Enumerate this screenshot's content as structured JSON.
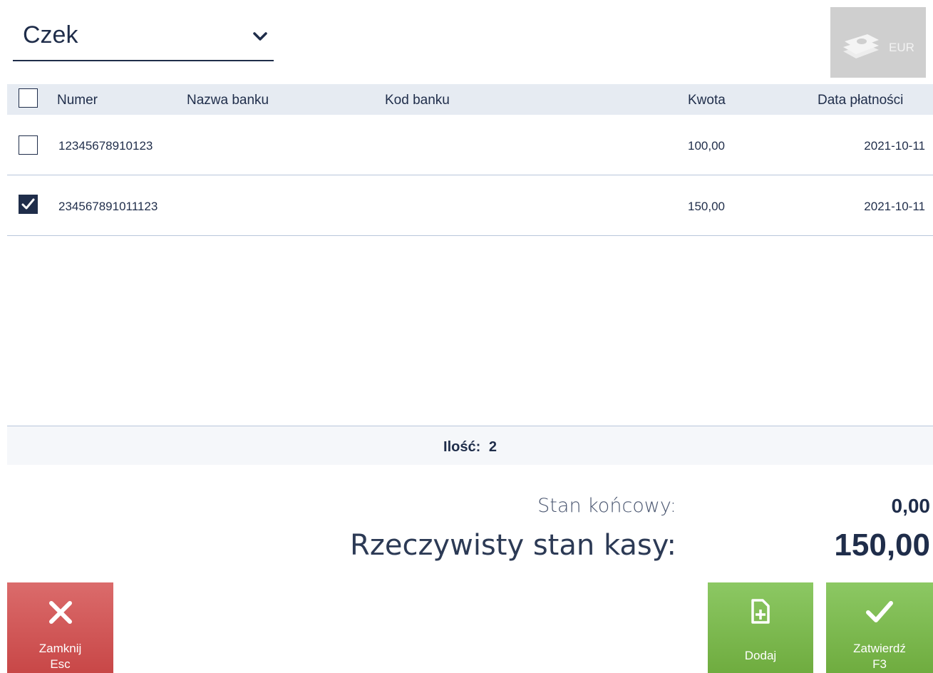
{
  "payment_type": {
    "selected": "Czek"
  },
  "currency_button": {
    "label": "EUR",
    "icon": "money-stack-icon",
    "enabled": false
  },
  "table": {
    "columns": [
      "Numer",
      "Nazwa banku",
      "Kod banku",
      "Kwota",
      "Data płatności"
    ],
    "rows": [
      {
        "checked": false,
        "numer": "12345678910123",
        "nazwa_banku": "",
        "kod_banku": "",
        "kwota": "100,00",
        "data": "2021-10-11"
      },
      {
        "checked": true,
        "numer": "234567891011123",
        "nazwa_banku": "",
        "kod_banku": "",
        "kwota": "150,00",
        "data": "2021-10-11"
      }
    ]
  },
  "count": {
    "label": "Ilość:",
    "value": "2"
  },
  "totals": {
    "stan_koncowy_label": "Stan końcowy:",
    "stan_koncowy_value": "0,00",
    "rzeczywisty_label": "Rzeczywisty stan kasy:",
    "rzeczywisty_value": "150,00"
  },
  "buttons": {
    "close": {
      "label": "Zamknij",
      "shortcut": "Esc",
      "icon": "close-icon"
    },
    "add": {
      "label": "Dodaj",
      "icon": "add-document-icon"
    },
    "confirm": {
      "label": "Zatwierdź",
      "shortcut": "F3",
      "icon": "checkmark-icon"
    }
  },
  "colors": {
    "primary": "#1f2d4a",
    "danger": "#c84747",
    "success": "#6fac3f",
    "header_bg": "#e6ebf2",
    "disabled": "#cfcfcf"
  }
}
